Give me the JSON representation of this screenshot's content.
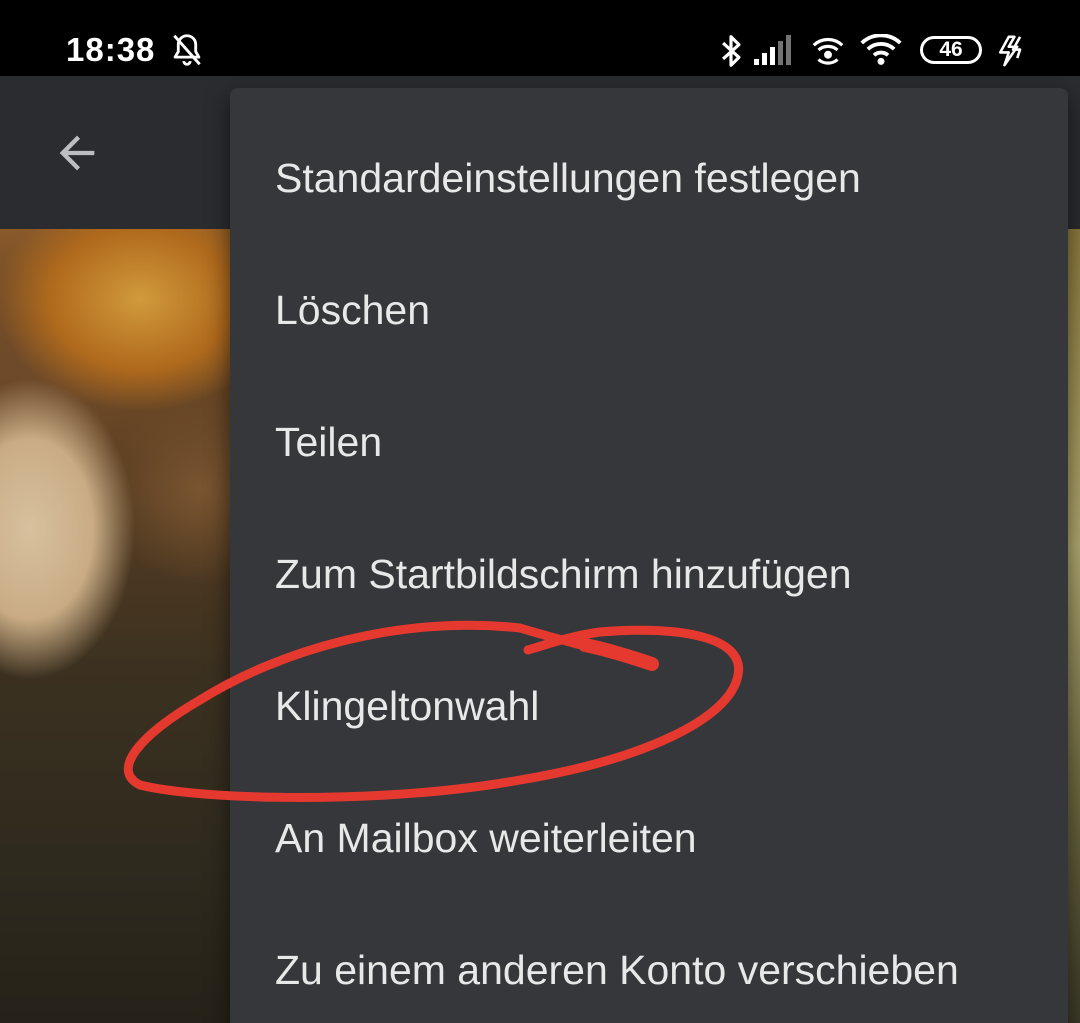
{
  "status_bar": {
    "time": "18:38",
    "battery_level": "46",
    "icons": [
      "bell-off-icon",
      "bluetooth-icon",
      "signal-icon",
      "hotspot-icon",
      "wifi-icon",
      "battery-icon",
      "charging-icon"
    ]
  },
  "app_bar": {
    "back_icon": "arrow-left-icon"
  },
  "menu": {
    "items": [
      {
        "label": "Standardeinstellungen festlegen"
      },
      {
        "label": "Löschen"
      },
      {
        "label": "Teilen"
      },
      {
        "label": "Zum Startbildschirm hinzufügen"
      },
      {
        "label": "Klingeltonwahl"
      },
      {
        "label": "An Mailbox weiterleiten"
      },
      {
        "label": "Zu einem anderen Konto verschieben"
      }
    ]
  },
  "annotation": {
    "color": "#e5392f",
    "highlighted_item": "Klingeltonwahl"
  },
  "colors": {
    "status_bar_bg": "#000000",
    "app_bar_bg": "#2b2c30",
    "menu_bg": "#36373b",
    "menu_text": "#e8e8e8"
  }
}
